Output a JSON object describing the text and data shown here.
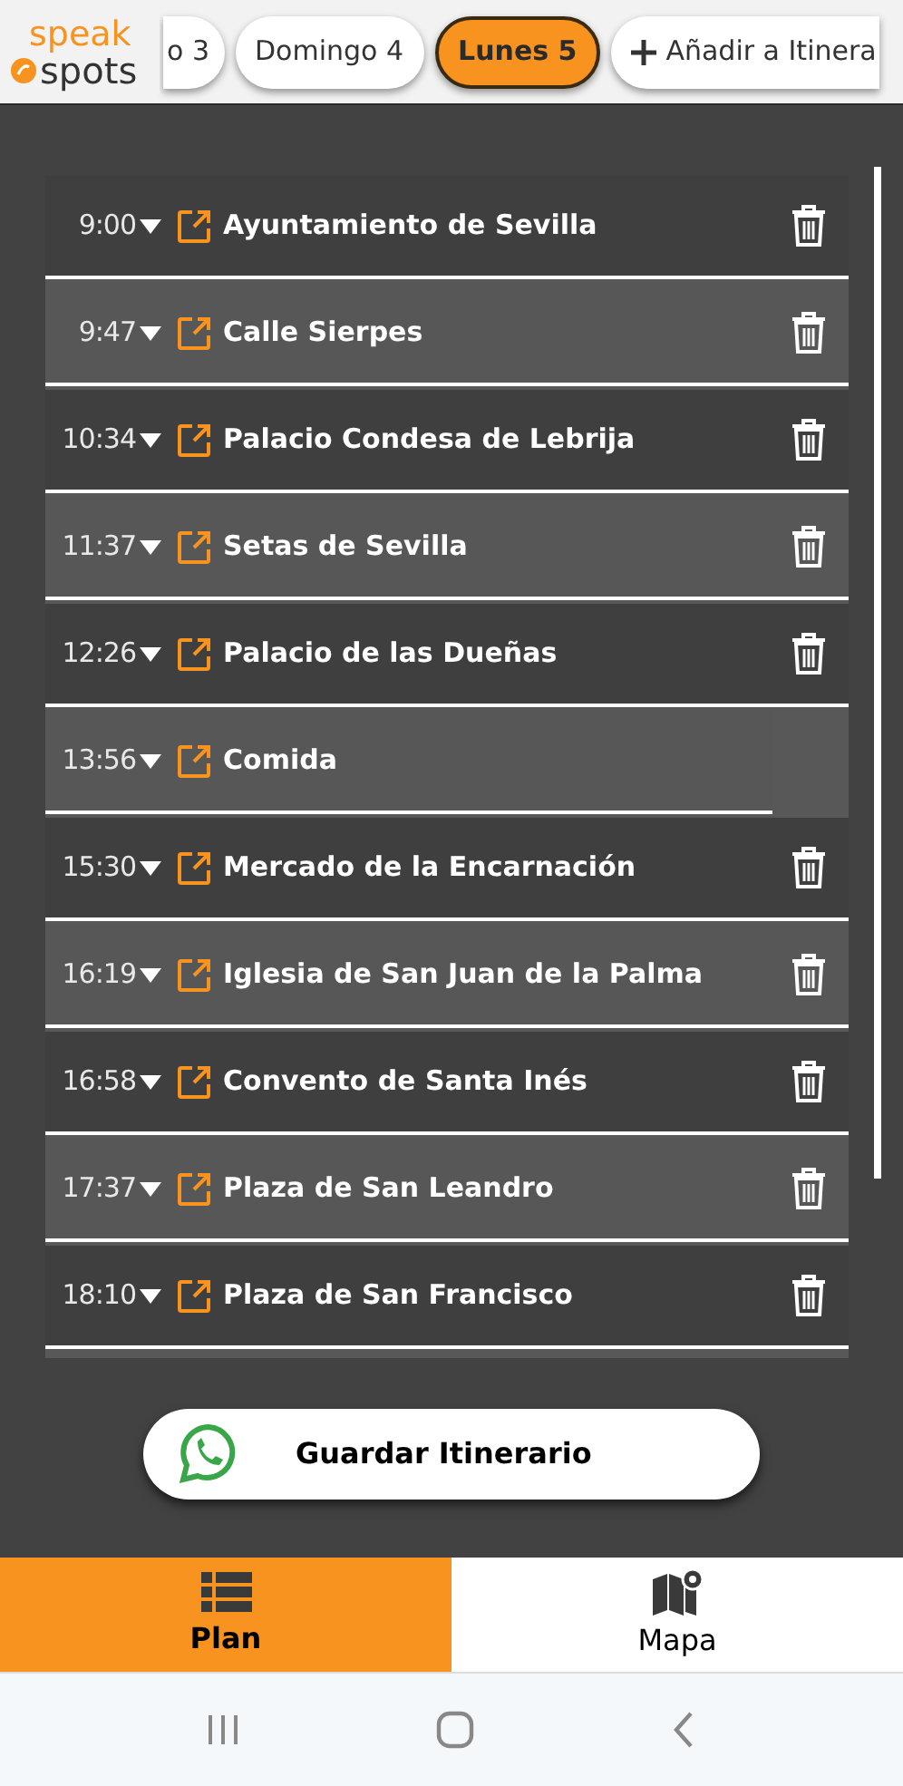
{
  "logo": {
    "line_1": "speak",
    "line_2": "spots"
  },
  "day_tabs": [
    {
      "label": "o 3",
      "selected": false
    },
    {
      "label": "Domingo 4",
      "selected": false
    },
    {
      "label": "Lunes 5",
      "selected": true
    }
  ],
  "add_button": {
    "label": "Añadir a Itinera"
  },
  "stops": [
    {
      "time": "9:00",
      "name": "Ayuntamiento de Sevilla",
      "deletable": true
    },
    {
      "time": "9:47",
      "name": "Calle Sierpes",
      "deletable": true
    },
    {
      "time": "10:34",
      "name": "Palacio Condesa de Lebrija",
      "deletable": true
    },
    {
      "time": "11:37",
      "name": "Setas de Sevilla",
      "deletable": true
    },
    {
      "time": "12:26",
      "name": "Palacio de las Dueñas",
      "deletable": true
    },
    {
      "time": "13:56",
      "name": "Comida",
      "deletable": false
    },
    {
      "time": "15:30",
      "name": "Mercado de la Encarnación",
      "deletable": true
    },
    {
      "time": "16:19",
      "name": "Iglesia de San Juan de la Palma",
      "deletable": true
    },
    {
      "time": "16:58",
      "name": "Convento de Santa Inés",
      "deletable": true
    },
    {
      "time": "17:37",
      "name": "Plaza de San Leandro",
      "deletable": true
    },
    {
      "time": "18:10",
      "name": "Plaza de San Francisco",
      "deletable": true
    }
  ],
  "save_button": {
    "label": "Guardar Itinerario"
  },
  "bottom_tabs": [
    {
      "label": "Plan",
      "kind": "list",
      "selected": true
    },
    {
      "label": "Mapa",
      "kind": "map",
      "selected": false
    }
  ]
}
